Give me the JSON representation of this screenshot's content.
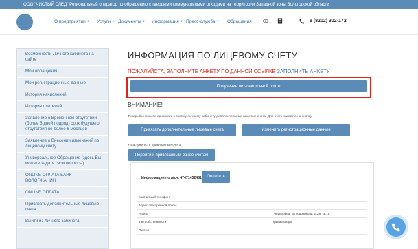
{
  "topbar": {
    "text": "ООО \"ЧИСТЫЙ СЛЕД\" Региональный оператор по обращению с твердыми коммунальными отходами на территории Западной зоны Вологодской области"
  },
  "nav": {
    "items": [
      {
        "label": "О предприятии",
        "has_dropdown": true
      },
      {
        "label": "Услуги",
        "has_dropdown": true
      },
      {
        "label": "Документы",
        "has_dropdown": true
      },
      {
        "label": "Информация",
        "has_dropdown": true
      },
      {
        "label": "Пресс-служба",
        "has_dropdown": true
      },
      {
        "label": "Обращения",
        "has_dropdown": false
      }
    ],
    "phone": "8 (8202) 302-172"
  },
  "sidebar": {
    "items": [
      {
        "label": "Возможности Личного кабинета на сайте"
      },
      {
        "label": "Мои обращения"
      },
      {
        "label": "Мои регистрационные данные"
      },
      {
        "label": "История начислений"
      },
      {
        "label": "История платежей"
      },
      {
        "label": "Заявление о Временном отсутствии (более 5 дней подряд) срок будущего отсутствия не более 6 месяцев"
      },
      {
        "label": "Заявление о Внесении изменений по лицевому счету"
      },
      {
        "label": "Универсальное Обращение (здесь Вы можете задать свои вопросы)"
      },
      {
        "label": "ONLINE ОПЛАТА БАНК ВОЛОГЖАНИН"
      },
      {
        "label": "ONLINE ОПЛАТА"
      },
      {
        "label": "Привязать дополнительные лицевые счета"
      },
      {
        "label": "Выйти из личного кабинета"
      }
    ]
  },
  "main": {
    "title": "ИНФОРМАЦИЯ ПО ЛИЦЕВОМУ СЧЕТУ",
    "warning": "ПОЖАЛУЙСТА, ЗАПОЛНИТЕ АНКЕТУ ПО ДАННОЙ ССЫЛКЕ",
    "warning_link": "ЗАПОЛНИТЬ АНКЕТУ",
    "email_button": "Получение по электронной почте",
    "attention_title": "ВНИМАНИЕ!",
    "attention_text": "Теперь Вы можете привязать к своему личному кабинету дополнительные лицевые счета. Для этого нажмите на кнопку",
    "bind_button": "Привязать дополнительные лицевые счета",
    "change_button": "Изменить регистрационные данные",
    "linked_text": "У Вас уже есть привязанные счета",
    "goto_button": "Перейти к привязанным ранее счетам",
    "account_label": "Информация по л/сч. 47471452481",
    "pay_button": "Оплатить",
    "rows": [
      {
        "key": "Контактный телефон",
        "value": ""
      },
      {
        "key": "Адрес электронной почты",
        "value": ""
      },
      {
        "key": "Адрес",
        "value": "г Череповец, ул Годовикова, д.28, кв.18"
      },
      {
        "key": "Тип собственности",
        "value": "Приватизация"
      },
      {
        "key": "Льготы",
        "value": ""
      }
    ]
  },
  "colors": {
    "accent": "#5b8cb8",
    "warning": "#d9261c",
    "link": "#3a6e9e",
    "sidebar_bg": "#e9eef4"
  },
  "icons": {
    "eye": "eye-icon",
    "doc": "document-icon",
    "phone": "phone-icon",
    "call": "call-button-icon"
  }
}
